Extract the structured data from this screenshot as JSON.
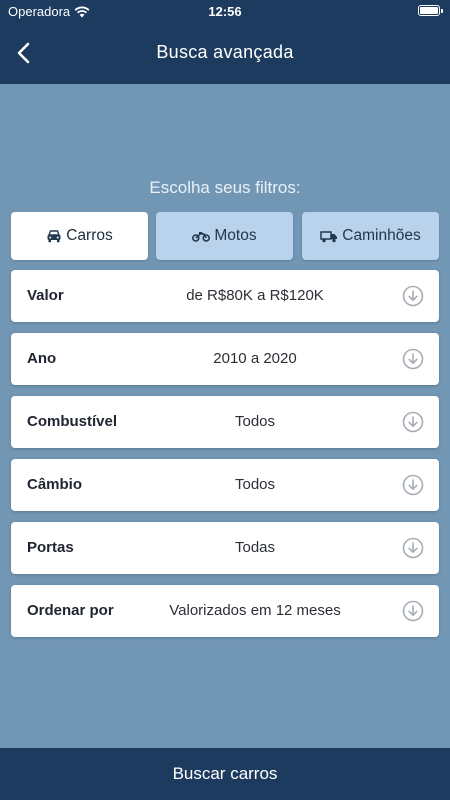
{
  "status": {
    "carrier": "Operadora",
    "time": "12:56"
  },
  "nav": {
    "title": "Busca avançada"
  },
  "prompt": "Escolha seus filtros:",
  "vehicle_tabs": [
    {
      "label": "Carros",
      "icon": "car-icon",
      "active": true
    },
    {
      "label": "Motos",
      "icon": "motorcycle-icon",
      "active": false
    },
    {
      "label": "Caminhões",
      "icon": "truck-icon",
      "active": false
    }
  ],
  "filters": [
    {
      "label": "Valor",
      "value": "de R$80K a R$120K"
    },
    {
      "label": "Ano",
      "value": "2010 a 2020"
    },
    {
      "label": "Combustível",
      "value": "Todos"
    },
    {
      "label": "Câmbio",
      "value": "Todos"
    },
    {
      "label": "Portas",
      "value": "Todas"
    },
    {
      "label": "Ordenar por",
      "value": "Valorizados em 12 meses"
    }
  ],
  "action": {
    "label": "Buscar carros"
  },
  "colors": {
    "primary": "#1d3b5f",
    "background": "#7297b5",
    "tab_inactive": "#b9d3ec"
  }
}
